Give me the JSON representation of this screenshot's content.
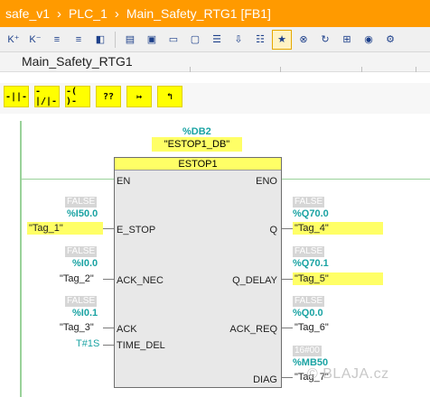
{
  "breadcrumb": [
    "safe_v1",
    "PLC_1",
    "Main_Safety_RTG1 [FB1]"
  ],
  "block_title": "Main_Safety_RTG1",
  "lad_buttons": [
    "-||-",
    "-|/|-",
    "-( )-",
    "??",
    "↦",
    "↰"
  ],
  "instance": {
    "address": "%DB2",
    "name": "\"ESTOP1_DB\""
  },
  "fb": {
    "name": "ESTOP1",
    "inputs": [
      "EN",
      "E_STOP",
      "ACK_NEC",
      "ACK",
      "TIME_DEL"
    ],
    "outputs": [
      "ENO",
      "Q",
      "Q_DELAY",
      "ACK_REQ",
      "DIAG"
    ]
  },
  "input_params": [
    {
      "status": "FALSE",
      "address": "%I50.0",
      "tag": "\"Tag_1\""
    },
    {
      "status": "FALSE",
      "address": "%I0.0",
      "tag": "\"Tag_2\""
    },
    {
      "status": "FALSE",
      "address": "%I0.1",
      "tag": "\"Tag_3\""
    }
  ],
  "time_del": "T#1S",
  "output_params": [
    {
      "status": "FALSE",
      "address": "%Q70.0",
      "tag": "\"Tag_4\""
    },
    {
      "status": "FALSE",
      "address": "%Q70.1",
      "tag": "\"Tag_5\""
    },
    {
      "status": "FALSE",
      "address": "%Q0.0",
      "tag": "\"Tag_6\""
    },
    {
      "status": "16#00",
      "address": "%MB50",
      "tag": "\"Tag_7\""
    }
  ],
  "watermark": "© BLAJA.cz"
}
